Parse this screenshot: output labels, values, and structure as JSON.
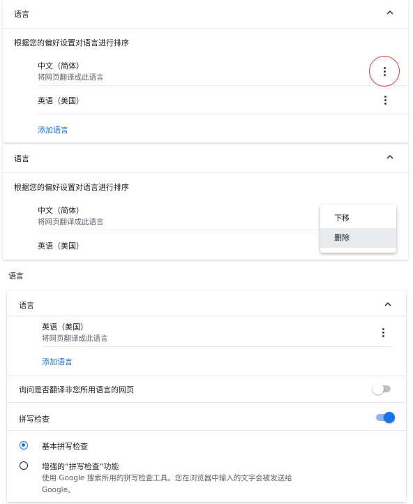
{
  "panel_top": {
    "section_title": "语言",
    "sort_label": "根据您的偏好设置对语言进行排序",
    "languages": [
      {
        "name": "中文（简体）",
        "subtitle": "将网页翻译成此语言"
      },
      {
        "name": "英语（美国）",
        "subtitle": ""
      }
    ],
    "add_language": "添加语言"
  },
  "panel_middle": {
    "section_title": "语言",
    "sort_label": "根据您的偏好设置对语言进行排序",
    "languages": [
      {
        "name": "中文（简体）",
        "subtitle": "将网页翻译成此语言"
      },
      {
        "name": "英语（美国）",
        "subtitle": ""
      }
    ],
    "context_menu": [
      "下移",
      "删除"
    ]
  },
  "panel_bottom": {
    "page_heading": "语言",
    "section_title": "语言",
    "languages": [
      {
        "name": "英语（美国）",
        "subtitle": "将网页翻译成此语言"
      }
    ],
    "add_language": "添加语言",
    "translate_prompt": {
      "label": "询问是否翻译非您所用语言的网页",
      "enabled": false
    },
    "spellcheck": {
      "label": "拼写检查",
      "enabled": true,
      "options": [
        {
          "label": "基本拼写检查",
          "selected": true,
          "description_line1": "",
          "description_line2": ""
        },
        {
          "label": "增强的“拼写检查”功能",
          "selected": false,
          "description_line1": "使用 Google 搜索所用的拼写检查工具。您在浏览器中输入的文字会被发送给",
          "description_line2": "Google。"
        }
      ]
    }
  },
  "colors": {
    "accent": "#1a73e8",
    "highlight_ring": "#e53935",
    "text_primary": "#202124",
    "text_secondary": "#5f6368"
  },
  "icons": [
    "chevron-up-icon",
    "more-vert-icon"
  ]
}
